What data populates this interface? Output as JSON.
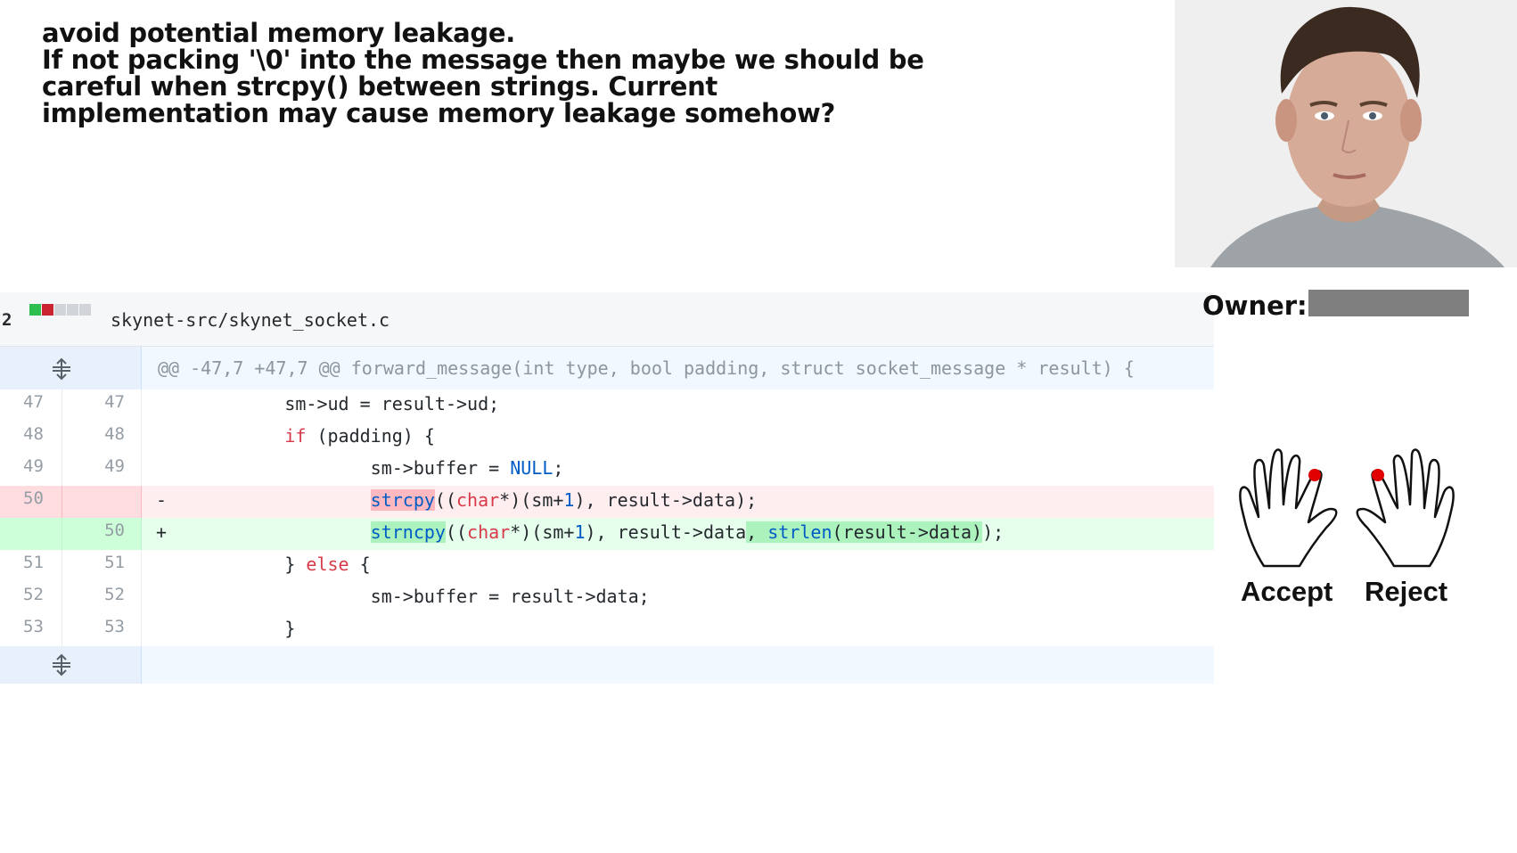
{
  "comment": {
    "lines": [
      "avoid potential memory leakage.",
      "If not packing '\\0' into the message then maybe we should be",
      "careful when strcpy() between strings. Current",
      "implementation may cause memory leakage somehow?"
    ]
  },
  "file": {
    "count": "2",
    "path": "skynet-src/skynet_socket.c",
    "diffstat_colors": [
      "#2cbe4e",
      "#cb2431",
      "#d1d5da",
      "#d1d5da",
      "#d1d5da"
    ]
  },
  "diff": {
    "hunk_header": "@@ -47,7 +47,7 @@ forward_message(int type, bool padding, struct socket_message * result) {",
    "lines": [
      {
        "old": "47",
        "new": "47"
      },
      {
        "old": "48",
        "new": "48"
      },
      {
        "old": "49",
        "new": "49"
      },
      {
        "old": "50",
        "new": "",
        "marker": "-"
      },
      {
        "old": "",
        "new": "50",
        "marker": "+"
      },
      {
        "old": "51",
        "new": "51"
      },
      {
        "old": "52",
        "new": "52"
      },
      {
        "old": "53",
        "new": "53"
      }
    ]
  },
  "owner": {
    "label": "Owner:"
  },
  "gestures": {
    "accept": "Accept",
    "reject": "Reject"
  },
  "icons": {
    "expand": "unfold-icon",
    "left_hand": "hand-icon",
    "right_hand": "hand-icon"
  },
  "colors": {
    "deletion_bg": "#ffeef0",
    "addition_bg": "#e6ffed",
    "hunk_bg": "#f1f8ff",
    "finger_dot": "#e00000",
    "owner_redaction": "#7f7f7f"
  }
}
